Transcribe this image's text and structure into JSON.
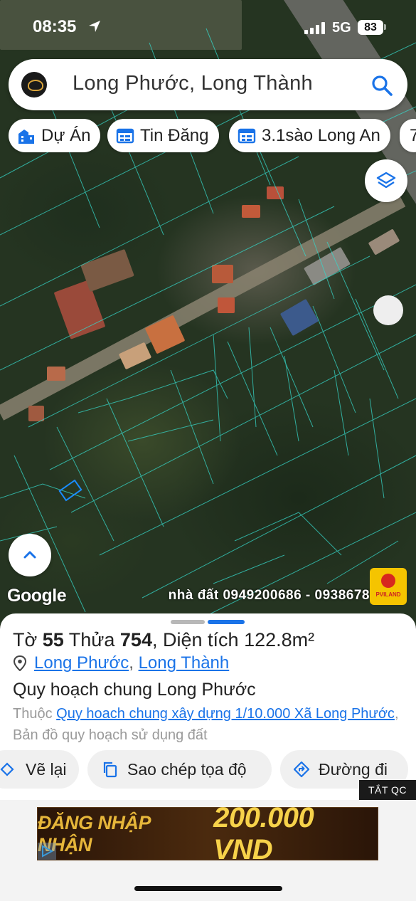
{
  "status_bar": {
    "time": "08:35",
    "network": "5G",
    "battery": "83"
  },
  "search": {
    "query": "Long Phước, Long Thành",
    "logo_icon": "brand-logo-icon",
    "search_icon": "search-icon"
  },
  "chips": [
    {
      "label": "Dự Án",
      "icon": "building-icon"
    },
    {
      "label": "Tin Đăng",
      "icon": "listing-icon"
    },
    {
      "label": "3.1sào Long An",
      "icon": "listing-icon"
    },
    {
      "label": "7",
      "icon": ""
    }
  ],
  "map": {
    "attribution": "Google",
    "watermark": "nhà đất 0949200686 - 0938678",
    "badge_text": "PVILAND"
  },
  "parcel": {
    "sheet_label": "Tờ",
    "sheet_no": "55",
    "lot_label": "Thửa",
    "lot_no": "754",
    "area_label": "Diện tích",
    "area_value": "122.8m²",
    "ward": "Long Phước",
    "separator": ",",
    "district": "Long Thành",
    "plan_title": "Quy hoạch chung Long Phước",
    "belongs_prefix": "Thuộc",
    "belongs_link": "Quy hoach chung xây dựng 1/10.000 Xã Long Phước",
    "belongs_suffix": ", Bản đồ quy hoạch sử dụng đất"
  },
  "actions": {
    "redraw": "Vẽ lại",
    "copy_coords": "Sao chép tọa độ",
    "directions": "Đường đi"
  },
  "ad": {
    "hide_label": "TẮT QC",
    "banner_text_1": "ĐĂNG NHẬP NHẬN",
    "banner_text_2": "200.000 VND"
  }
}
